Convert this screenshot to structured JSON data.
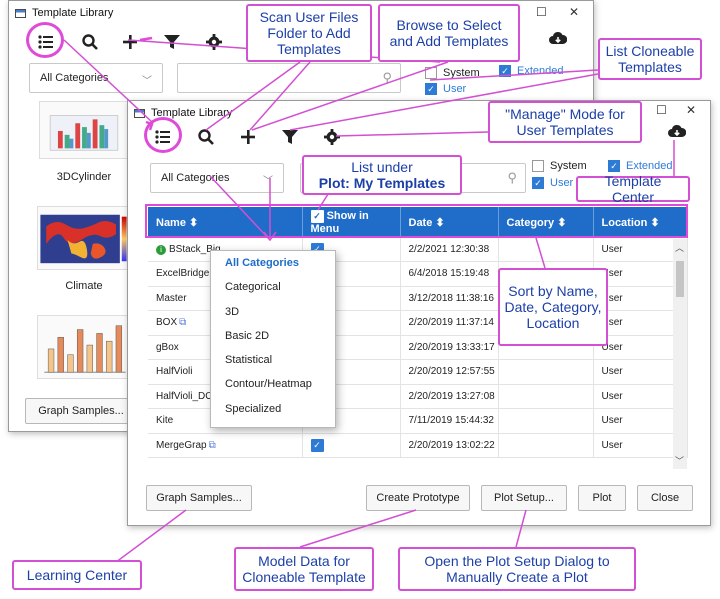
{
  "back_window": {
    "title": "Template Library",
    "category_value": "All Categories",
    "system_label": "System",
    "extended_label": "Extended",
    "user_label": "User",
    "thumbnails": [
      {
        "label": "3DCylinder"
      },
      {
        "label": "Climate"
      },
      {
        "label": ""
      }
    ],
    "graph_samples_label": "Graph Samples..."
  },
  "front_window": {
    "title": "Template Library",
    "category_value": "All Categories",
    "system_label": "System",
    "extended_label": "Extended",
    "user_label": "User",
    "columns": [
      "Name",
      "Show in Menu",
      "Date",
      "Category",
      "Location"
    ],
    "sort_glyph": "⬍",
    "rows": [
      {
        "name": "BStack_Big",
        "date": "2/2/2021 12:30:38",
        "location": "User",
        "info": true
      },
      {
        "name": "ExcelBridge",
        "date": "6/4/2018 15:19:48",
        "location": "User"
      },
      {
        "name": "Master",
        "date": "3/12/2018 11:38:16",
        "location": "User"
      },
      {
        "name": "BOX",
        "date": "2/20/2019 11:37:14",
        "location": "User",
        "link": true
      },
      {
        "name": "gBox",
        "date": "2/20/2019 13:33:17",
        "location": "User"
      },
      {
        "name": "HalfVioli",
        "date": "2/20/2019 12:57:55",
        "location": "User"
      },
      {
        "name": "HalfVioli_DOTS",
        "date": "2/20/2019 13:27:08",
        "location": "User"
      },
      {
        "name": "Kite",
        "date": "7/11/2019 15:44:32",
        "location": "User"
      },
      {
        "name": "MergeGrap",
        "date": "2/20/2019 13:02:22",
        "location": "User",
        "link": true
      }
    ],
    "buttons": {
      "graph_samples": "Graph Samples...",
      "create_prototype": "Create Prototype",
      "plot_setup": "Plot Setup...",
      "plot": "Plot",
      "close": "Close"
    }
  },
  "category_menu": [
    "All Categories",
    "Categorical",
    "3D",
    "Basic 2D",
    "Statistical",
    "Contour/Heatmap",
    "Specialized"
  ],
  "callouts": {
    "scan": "Scan User Files Folder to Add Templates",
    "browse": "Browse to Select and Add Templates",
    "cloneable": "List Cloneable Templates",
    "manage": "\"Manage\" Mode for User Templates",
    "list_under_1": "List under",
    "list_under_2": "Plot: My Templates",
    "template_center": "Template Center",
    "sort": "Sort by Name, Date, Category, Location",
    "learning": "Learning Center",
    "model_data": "Model Data for Cloneable Template",
    "plot_setup_dialog": "Open the Plot Setup Dialog to Manually Create a Plot"
  },
  "colors": {
    "accent": "#1f6dc9",
    "highlight": "#e04ad8",
    "callout_text": "#1c3fa8"
  },
  "icons": [
    "list-icon",
    "search-icon",
    "plus-icon",
    "filter-icon",
    "gear-icon",
    "cloud-download-icon"
  ]
}
